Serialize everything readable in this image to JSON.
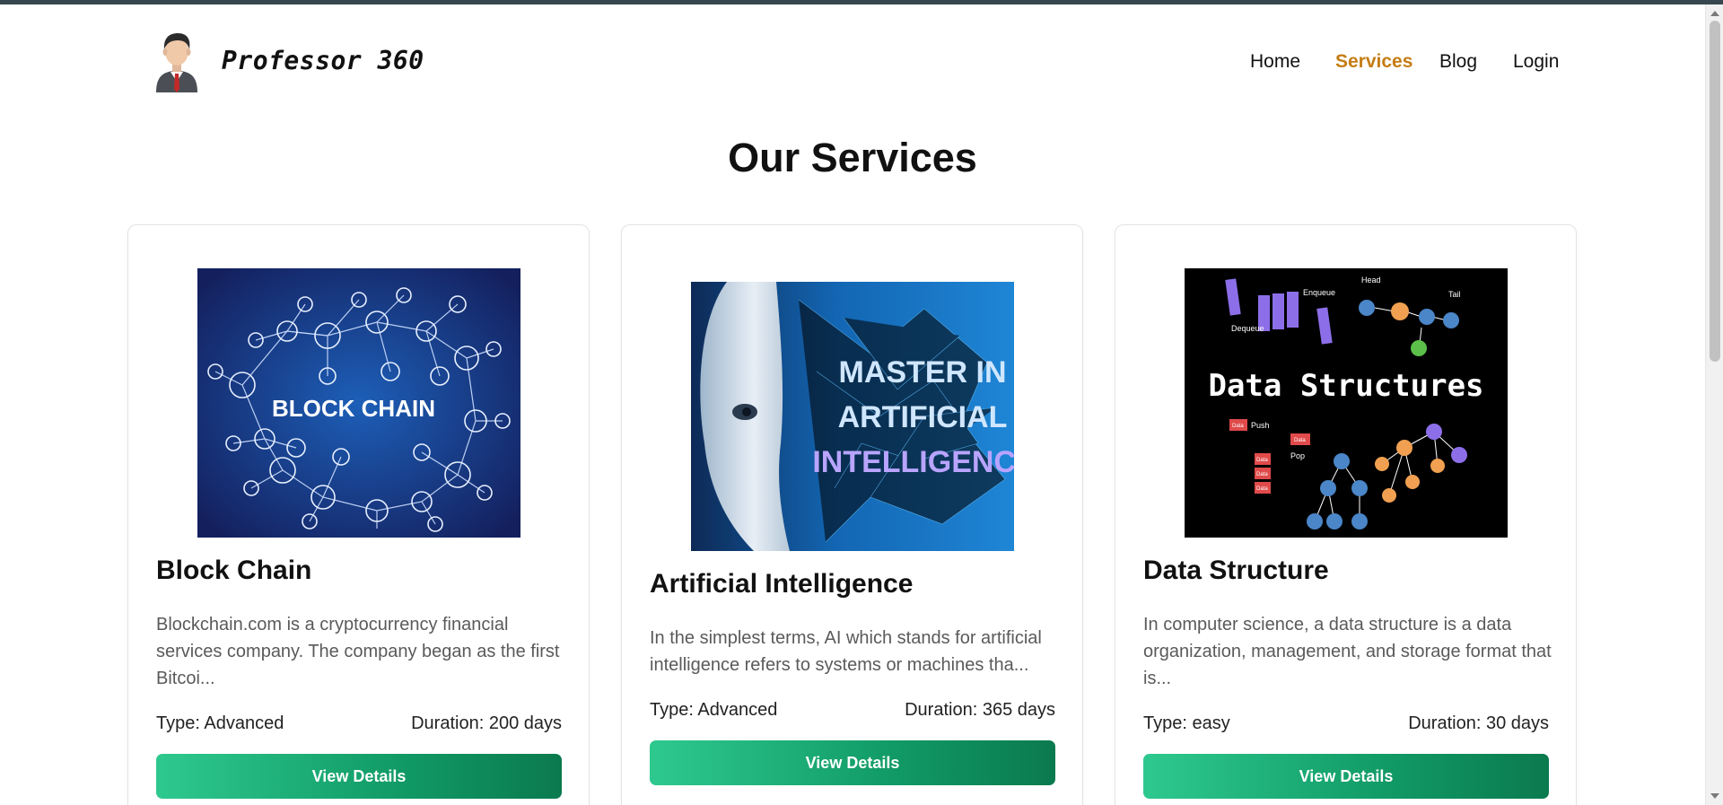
{
  "brand": {
    "name": "Professor 360"
  },
  "nav": [
    {
      "label": "Home",
      "active": false
    },
    {
      "label": "Services",
      "active": true
    },
    {
      "label": "Blog",
      "active": false
    },
    {
      "label": "Login",
      "active": false
    }
  ],
  "page": {
    "title": "Our Services"
  },
  "services": [
    {
      "title": "Block Chain",
      "image_text": "BLOCK CHAIN",
      "description": "Blockchain.com is a cryptocurrency financial services company. The company began as the first Bitcoi...",
      "type": "Type: Advanced",
      "duration": "Duration: 200 days",
      "button": "View Details"
    },
    {
      "title": "Artificial Intelligence",
      "image_text": [
        "MASTER IN",
        "ARTIFICIAL",
        "INTELLIGENCE"
      ],
      "description": "In the simplest terms, AI which stands for artificial intelligence refers to systems or machines tha...",
      "type": "Type: Advanced",
      "duration": "Duration: 365 days",
      "button": "View Details"
    },
    {
      "title": "Data Structure",
      "image_text": {
        "title": "Data Structures",
        "labels": [
          "Head",
          "Enqueue",
          "Tail",
          "Dequeue",
          "Push",
          "Pop",
          "Data",
          "Data",
          "Data",
          "Data",
          "Data"
        ]
      },
      "description": "In computer science, a data structure is a data organization, management, and storage format that is...",
      "type": "Type: easy",
      "duration": "Duration: 30 days",
      "button": "View Details"
    }
  ],
  "colors": {
    "accent": "#c57d14",
    "button_start": "#2ec98f",
    "button_end": "#0b7a4e",
    "top_strip": "#37474f"
  }
}
